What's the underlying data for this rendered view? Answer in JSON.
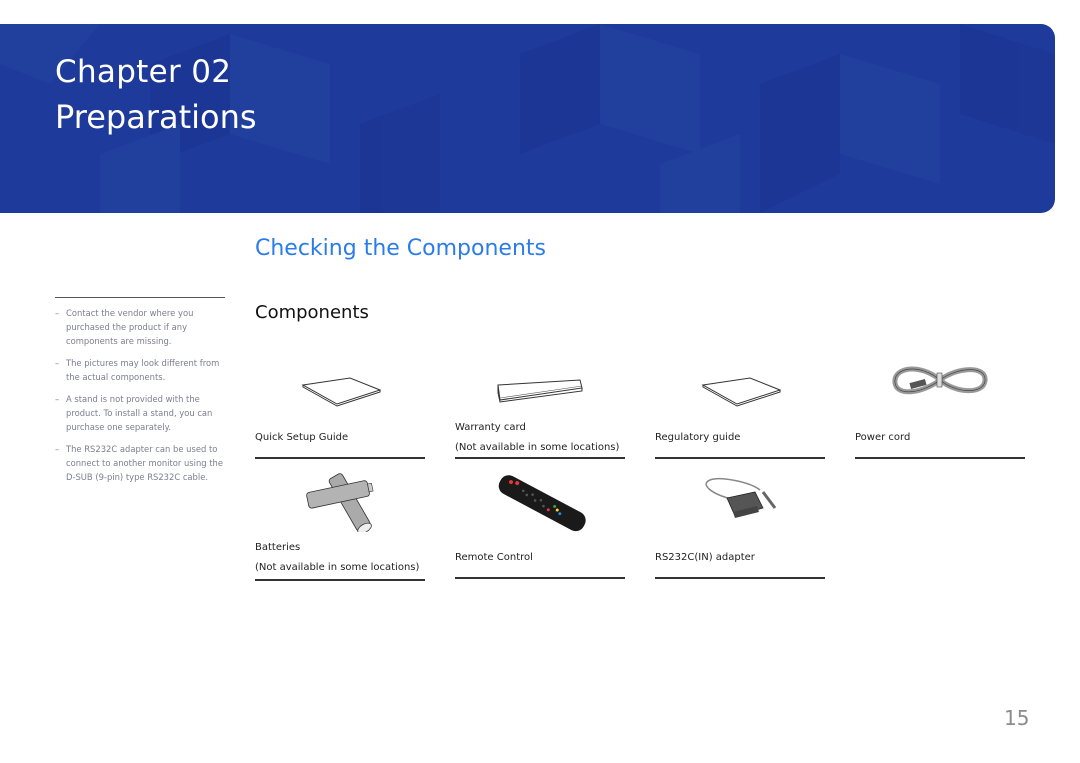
{
  "banner": {
    "chapter": "Chapter  02",
    "title": "Preparations",
    "color": "#1e3a9a"
  },
  "section_title": "Checking the Components",
  "subsection_title": "Components",
  "notes": [
    "Contact the vendor where you purchased the product if any components are missing.",
    "The pictures may look different from the actual components.",
    "A stand is not provided with the product. To install a stand, you can purchase one separately.",
    "The RS232C adapter can be used to connect to another monitor using the D-SUB (9-pin) type RS232C cable."
  ],
  "note_bullet": "–",
  "components": [
    {
      "name": "Quick Setup Guide",
      "note": "",
      "icon": "booklet-icon"
    },
    {
      "name": "Warranty card",
      "note": "(Not available in some locations)",
      "icon": "card-icon"
    },
    {
      "name": "Regulatory guide",
      "note": "",
      "icon": "booklet-icon"
    },
    {
      "name": "Power cord",
      "note": "",
      "icon": "power-cord-icon"
    },
    {
      "name": "Batteries",
      "note": "(Not available in some locations)",
      "icon": "batteries-icon"
    },
    {
      "name": "Remote Control",
      "note": "",
      "icon": "remote-control-icon"
    },
    {
      "name": "RS232C(IN) adapter",
      "note": "",
      "icon": "rs232c-adapter-icon"
    }
  ],
  "page_number": "15",
  "accent_color": "#2b7ce9"
}
